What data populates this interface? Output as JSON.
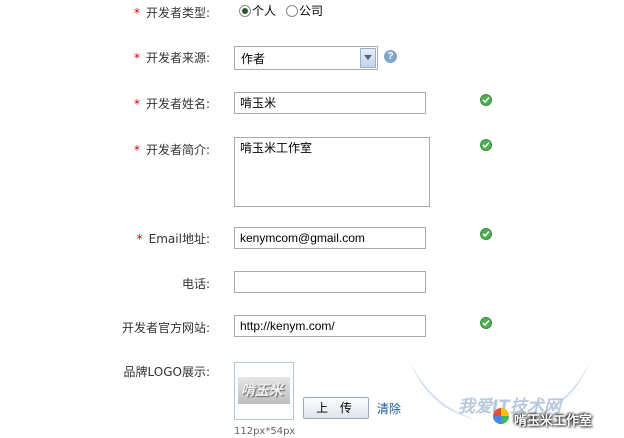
{
  "form": {
    "dev_type": {
      "required_mark": "*",
      "label": "开发者类型:",
      "options": [
        {
          "label": "个人",
          "selected": true
        },
        {
          "label": "公司",
          "selected": false
        }
      ]
    },
    "dev_source": {
      "required_mark": "*",
      "label": "开发者来源:",
      "value": "作者",
      "help_icon": "help-icon"
    },
    "dev_name": {
      "required_mark": "*",
      "label": "开发者姓名:",
      "value": "啃玉米",
      "status_icon": "check-icon"
    },
    "dev_intro": {
      "required_mark": "*",
      "label": "开发者简介:",
      "value": "啃玉米工作室",
      "status_icon": "check-icon"
    },
    "email": {
      "required_mark": "*",
      "label": "Email地址:",
      "value": "kenymcom@gmail.com",
      "status_icon": "check-icon"
    },
    "phone": {
      "label": "电话:",
      "value": ""
    },
    "website": {
      "label": "开发者官方网站:",
      "value": "http://kenym.com/",
      "status_icon": "check-icon"
    },
    "logo": {
      "label": "品牌LOGO展示:",
      "logo_text": "啃玉米",
      "upload_label": "上 传",
      "clear_label": "清除",
      "size_hint": "112px*54px"
    }
  },
  "watermark": {
    "line1": "我爱IT技术网",
    "line2": "啃玉米工作室"
  },
  "colors": {
    "required": "#cc0000",
    "check": "#4caf50",
    "link": "#1a5b9e"
  }
}
